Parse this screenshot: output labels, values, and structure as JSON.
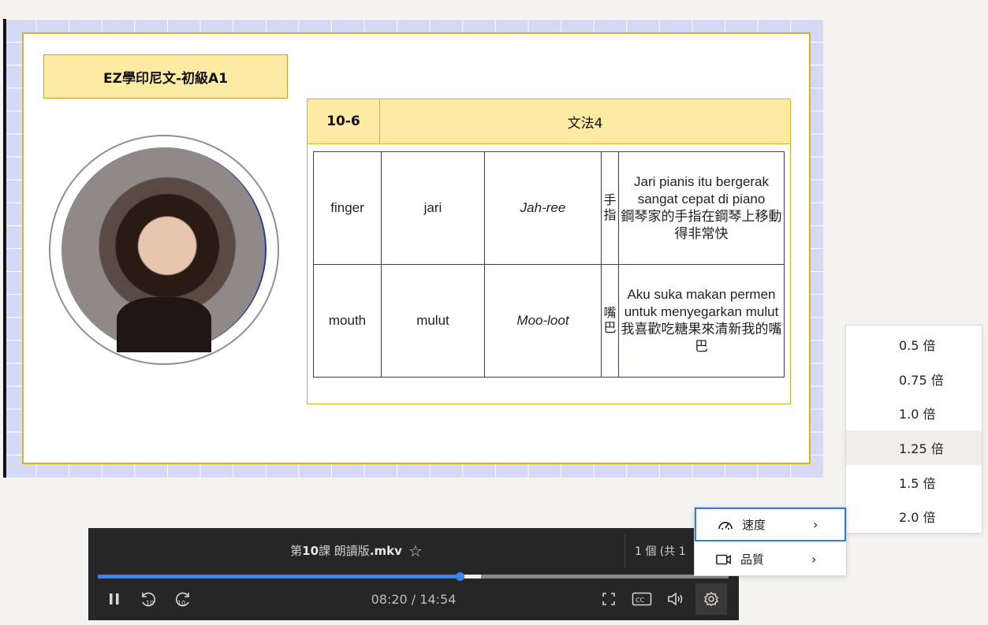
{
  "slide": {
    "course_title": "EZ學印尼文-初級A1",
    "lesson_code": "10-6",
    "lesson_topic": "文法4",
    "rows": [
      {
        "english": "finger",
        "indonesian": "jari",
        "pronunciation": "Jah-ree",
        "chinese": "手指",
        "example_id": "Jari pianis itu bergerak sangat cepat di piano",
        "example_zh": "鋼琴家的手指在鋼琴上移動得非常快"
      },
      {
        "english": "mouth",
        "indonesian": "mulut",
        "pronunciation": "Moo-loot",
        "chinese": "嘴巴",
        "example_id": "Aku suka makan permen untuk menyegarkan mulut",
        "example_zh": "我喜歡吃糖果來清新我的嘴巴"
      }
    ]
  },
  "player": {
    "file_prefix": "第",
    "file_number": "10",
    "file_middle": "課 朗讀版",
    "file_ext": ".mkv",
    "star_icon": "star-outline-icon",
    "playlist_count": "1 個 (共 1",
    "time": "08:20 / 14:54",
    "progress_played": 0.5733,
    "progress_buffered": 0.6075,
    "accent_color": "#3b82f6",
    "icons": [
      "pause-icon",
      "rewind-10-icon",
      "forward-10-icon",
      "fullscreen-icon",
      "captions-icon",
      "volume-icon",
      "settings-icon"
    ]
  },
  "settings_menu": {
    "items": [
      {
        "label": "速度",
        "icon": "speedometer-icon",
        "arrow": "›"
      },
      {
        "label": "品質",
        "icon": "video-camera-icon",
        "arrow": "›"
      }
    ]
  },
  "speed_menu": {
    "options": [
      "0.5 倍",
      "0.75 倍",
      "1.0 倍",
      "1.25 倍",
      "1.5 倍",
      "2.0 倍"
    ],
    "selected": "1.25 倍"
  }
}
